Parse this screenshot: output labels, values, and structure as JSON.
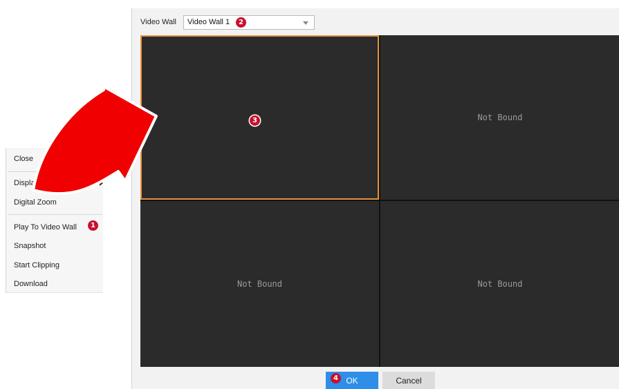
{
  "dialog": {
    "video_wall_label": "Video Wall",
    "video_wall_value": "Video Wall 1",
    "cells": [
      {
        "text": ""
      },
      {
        "text": "Not Bound"
      },
      {
        "text": "Not Bound"
      },
      {
        "text": "Not Bound"
      }
    ],
    "ok_label": "OK",
    "cancel_label": "Cancel"
  },
  "context_menu": {
    "items": [
      {
        "label": "Close"
      },
      {
        "label": "Display Ratio"
      },
      {
        "label": "Digital Zoom"
      },
      {
        "label": "Play To Video Wall"
      },
      {
        "label": "Snapshot"
      },
      {
        "label": "Start Clipping"
      },
      {
        "label": "Download"
      }
    ]
  },
  "badges": {
    "b1": "1",
    "b2": "2",
    "b3": "3",
    "b4": "4"
  },
  "colors": {
    "selected_border": "#e8923a",
    "badge": "#c8102e",
    "ok_button": "#2e8ee8",
    "callout_arrow": "#ff0000"
  },
  "icons": {
    "dropdown": "chevron-down-icon",
    "submenu": "chevron-right-icon",
    "callout": "curved-arrow-icon"
  }
}
